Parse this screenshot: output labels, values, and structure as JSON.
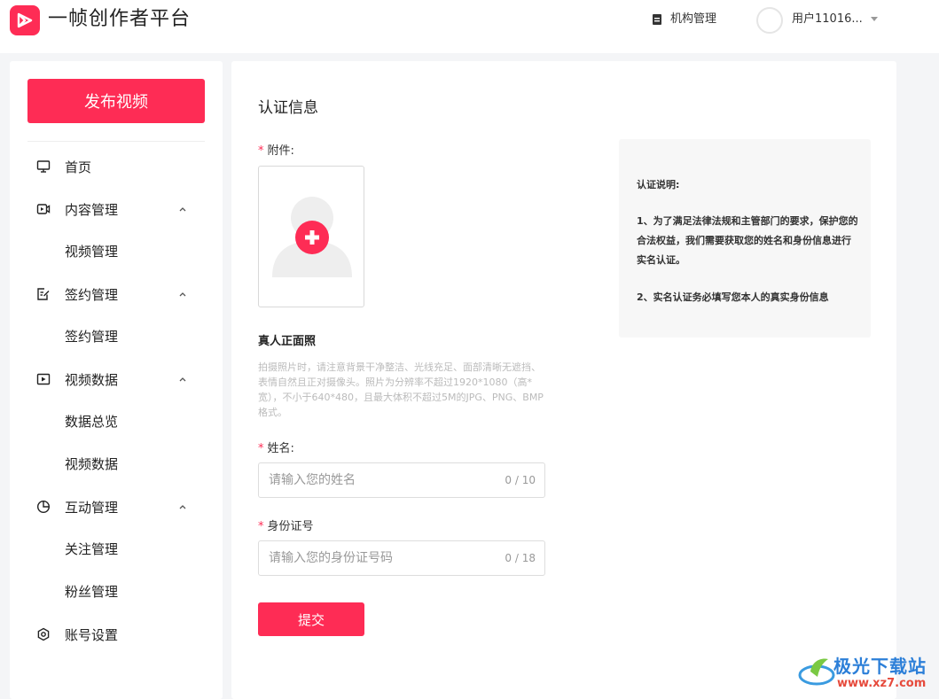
{
  "header": {
    "brand": "一帧创作者平台",
    "org_label": "机构管理",
    "username": "用户11016..."
  },
  "sidebar": {
    "publish_label": "发布视频",
    "items": [
      {
        "label": "首页",
        "icon": "monitor-icon"
      },
      {
        "label": "内容管理",
        "icon": "video-camera-icon"
      },
      {
        "label": "视频管理"
      },
      {
        "label": "签约管理",
        "icon": "edit-document-icon"
      },
      {
        "label": "签约管理"
      },
      {
        "label": "视频数据",
        "icon": "play-square-icon"
      },
      {
        "label": "数据总览"
      },
      {
        "label": "视频数据"
      },
      {
        "label": "互动管理",
        "icon": "pie-chart-icon"
      },
      {
        "label": "关注管理"
      },
      {
        "label": "粉丝管理"
      },
      {
        "label": "账号设置",
        "icon": "hexagon-settings-icon"
      }
    ]
  },
  "main": {
    "title": "认证信息",
    "required_mark": "*",
    "attachment_label": "附件:",
    "photo_title": "真人正面照",
    "photo_desc": "拍摄照片时，请注意背景干净整洁、光线充足、面部清晰无遮挡、表情自然且正对摄像头。照片为分辨率不超过1920*1080（高*宽），不小于640*480，且最大体积不超过5M的JPG、PNG、BMP格式。",
    "name_label": "姓名:",
    "name_placeholder": "请输入您的姓名",
    "name_counter": "0 / 10",
    "id_label": "身份证号",
    "id_placeholder": "请输入您的身份证号码",
    "id_counter": "0 / 18",
    "submit_label": "提交"
  },
  "note": {
    "title": "认证说明:",
    "item1": "1、为了满足法律法规和主管部门的要求，保护您的合法权益，我们需要获取您的姓名和身份信息进行实名认证。",
    "item2": "2、实名认证务必填写您本人的真实身份信息"
  },
  "watermark": {
    "text": "极光下载站",
    "url": "www.xz7.com"
  },
  "colors": {
    "accent": "#fe2c55"
  }
}
